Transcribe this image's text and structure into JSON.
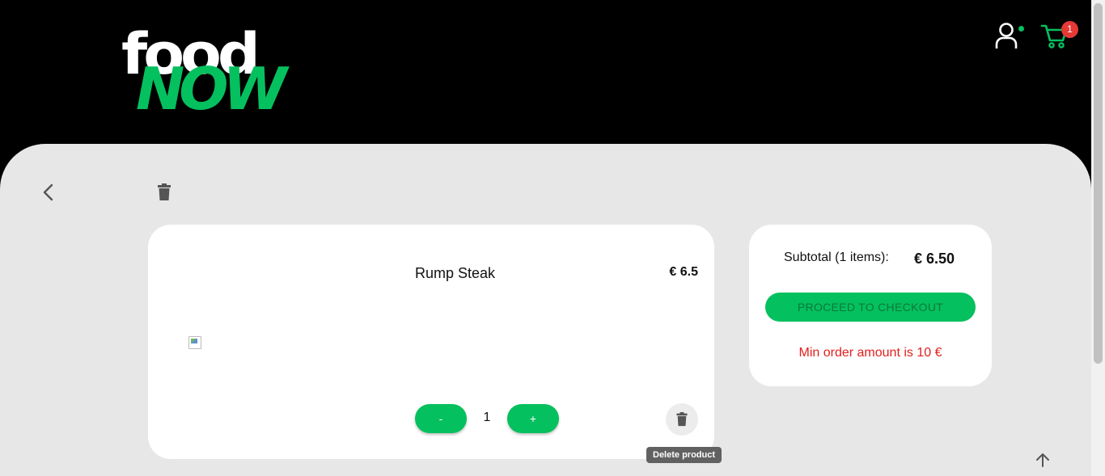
{
  "header": {
    "logo_top": "food",
    "logo_bottom": "NOW",
    "cart_count": "1",
    "icons": {
      "user": "user-icon",
      "cart": "cart-icon"
    },
    "colors": {
      "brand_green": "#05c05e",
      "badge_red": "#e53935"
    }
  },
  "toolbar": {
    "back_icon": "chevron-left-icon",
    "clear_icon": "trash-icon"
  },
  "cart": {
    "items": [
      {
        "name": "Rump Steak",
        "price": "€ 6.5",
        "quantity": "1",
        "minus_label": "-",
        "plus_label": "+"
      }
    ],
    "delete_tooltip": "Delete product"
  },
  "summary": {
    "subtotal_label": "Subtotal (1 items):",
    "subtotal_value": "€ 6.50",
    "checkout_label": "PROCEED TO CHECKOUT",
    "min_order_message": "Min order amount is 10 €"
  },
  "scroll_top_icon": "arrow-up-icon"
}
